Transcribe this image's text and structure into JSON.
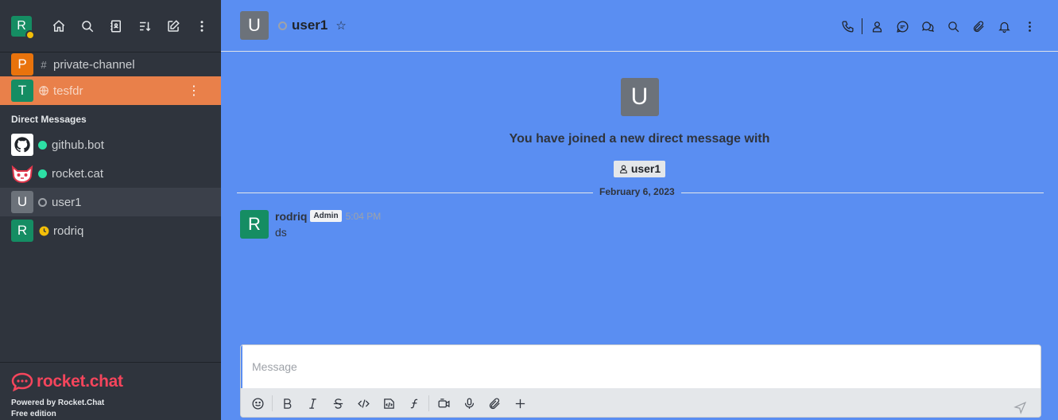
{
  "user": {
    "initial": "R",
    "status": "away"
  },
  "sidebar": {
    "rooms": [
      {
        "initial": "P",
        "color": "#e9730c",
        "name": "private-channel",
        "icon": "hashtag-lock-icon"
      },
      {
        "initial": "T",
        "color": "#158d63",
        "name": "tesfdr",
        "icon": "globe-icon"
      }
    ],
    "dm_title": "Direct Messages",
    "dms": [
      {
        "name": "github.bot",
        "status": "online"
      },
      {
        "name": "rocket.cat",
        "status": "online"
      },
      {
        "initial": "U",
        "color": "#6c727a",
        "name": "user1",
        "status": "offline"
      },
      {
        "initial": "R",
        "color": "#158d63",
        "name": "rodriq",
        "status": "away"
      }
    ],
    "footer": {
      "brand": "rocket.chat",
      "powered": "Powered by Rocket.Chat",
      "edition": "Free edition"
    }
  },
  "header": {
    "initial": "U",
    "title": "user1"
  },
  "intro": {
    "initial": "U",
    "text": "You have joined a new direct message with",
    "chip": "user1"
  },
  "divider": {
    "date": "February 6, 2023"
  },
  "messages": [
    {
      "initial": "R",
      "username": "rodriq",
      "role": "Admin",
      "time": "5:04 PM",
      "text": "ds"
    }
  ],
  "composer": {
    "placeholder": "Message"
  },
  "colors": {
    "background": "#5a8ef2",
    "sidebar": "#2f343d",
    "active_room": "#e9804a",
    "brand": "#f5455c"
  }
}
